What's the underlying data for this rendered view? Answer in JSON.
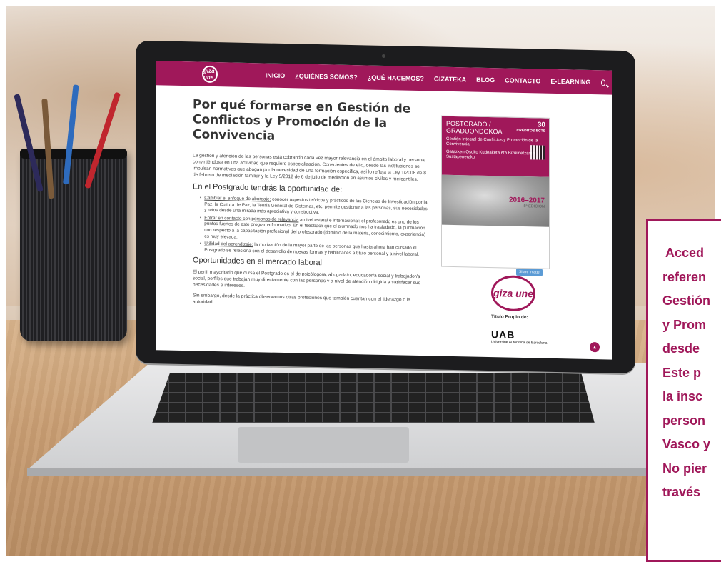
{
  "nav": {
    "logo_text": "giza une",
    "items": [
      "INICIO",
      "¿QUIÉNES SOMOS?",
      "¿QUÉ HACEMOS?",
      "GIZATEKA",
      "BLOG",
      "CONTACTO",
      "E-LEARNING"
    ]
  },
  "article": {
    "title": "Por qué formarse en Gestión de Conflictos y Promoción de la Convivencia",
    "intro": "La gestión y atención de las personas está cobrando cada vez mayor relevancia en el ámbito laboral y personal convirtiéndose en una actividad que requiere especialización. Conscientes de ello, desde las instituciones se impulsan normativas que abogan por la necesidad de una formación específica, así lo refleja la Ley 1/2008 de 8 de febrero de mediación familiar y la Ley 5/2012 de 6 de julio de mediación en asuntos civiles y mercantiles.",
    "h2_1": "En el Postgrado tendrás la oportunidad de:",
    "bullets": [
      {
        "lead": "Cambiar el enfoque de abordaje:",
        "text": " conocer aspectos teóricos y prácticos de las Ciencias de Investigación por la Paz, la Cultura de Paz, la Teoría General de Sistemas, etc. permite gestionar a las personas, sus necesidades y retos desde una mirada más apreciativa y constructiva."
      },
      {
        "lead": "Entrar en contacto con personas de relevancia",
        "text": " a nivel estatal e internacional: el profesorado es uno de los puntos fuertes de este programa formativo. En el feedback que el alumnado nos ha trasladado, la puntuación con respecto a la capacitación profesional del profesorado (dominio de la materia, conocimiento, experiencia) es muy elevada."
      },
      {
        "lead": "Utilidad del aprendizaje:",
        "text": " la motivación de la mayor parte de las personas que hasta ahora han cursado el Postgrado se relaciona con el desarrollo de nuevas formas y habilidades a título personal y a nivel laboral."
      }
    ],
    "h2_2": "Oportunidades en el mercado laboral",
    "p2": "El perfil mayoritario que cursa el Postgrado es el de psicólogo/a, abogada/o, educador/a social y trabajador/a social, perfiles que trabajan muy directamente con las personas y a nivel de atención dirigida a satisfacer sus necesidades e intereses.",
    "p3": "Sin embargo, desde la práctica observamos otras profesiones que también cuentan con el liderazgo o la autoridad ..."
  },
  "poster": {
    "title": "POSTGRADO / GRADUONDOKOA",
    "subtitle": "Gestión Integral de Conflictos y Promoción de la Convivencia",
    "subtitle_eu": "Gatazken Osoko Kudeaketa eta Bizikidetzaren Sustapenerako",
    "credits": "30",
    "credits_label": "CRÉDITOS ECTS",
    "years": "2016–2017",
    "edition": "5ª EDICIÓN"
  },
  "sidebar": {
    "share_label": "Share Image",
    "logo_text": "giza une",
    "titulo_label": "Título Propio de:",
    "uab_label": "UAB",
    "uab_sub": "Universitat Autònoma de Barcelona"
  },
  "overlay": {
    "lines": [
      "Acced",
      "referen",
      "Gestión",
      "y Prom",
      "desde",
      "Este p",
      "la insc",
      "person",
      "Vasco y",
      "No pier",
      "través"
    ]
  },
  "colors": {
    "brand": "#a0185a"
  }
}
